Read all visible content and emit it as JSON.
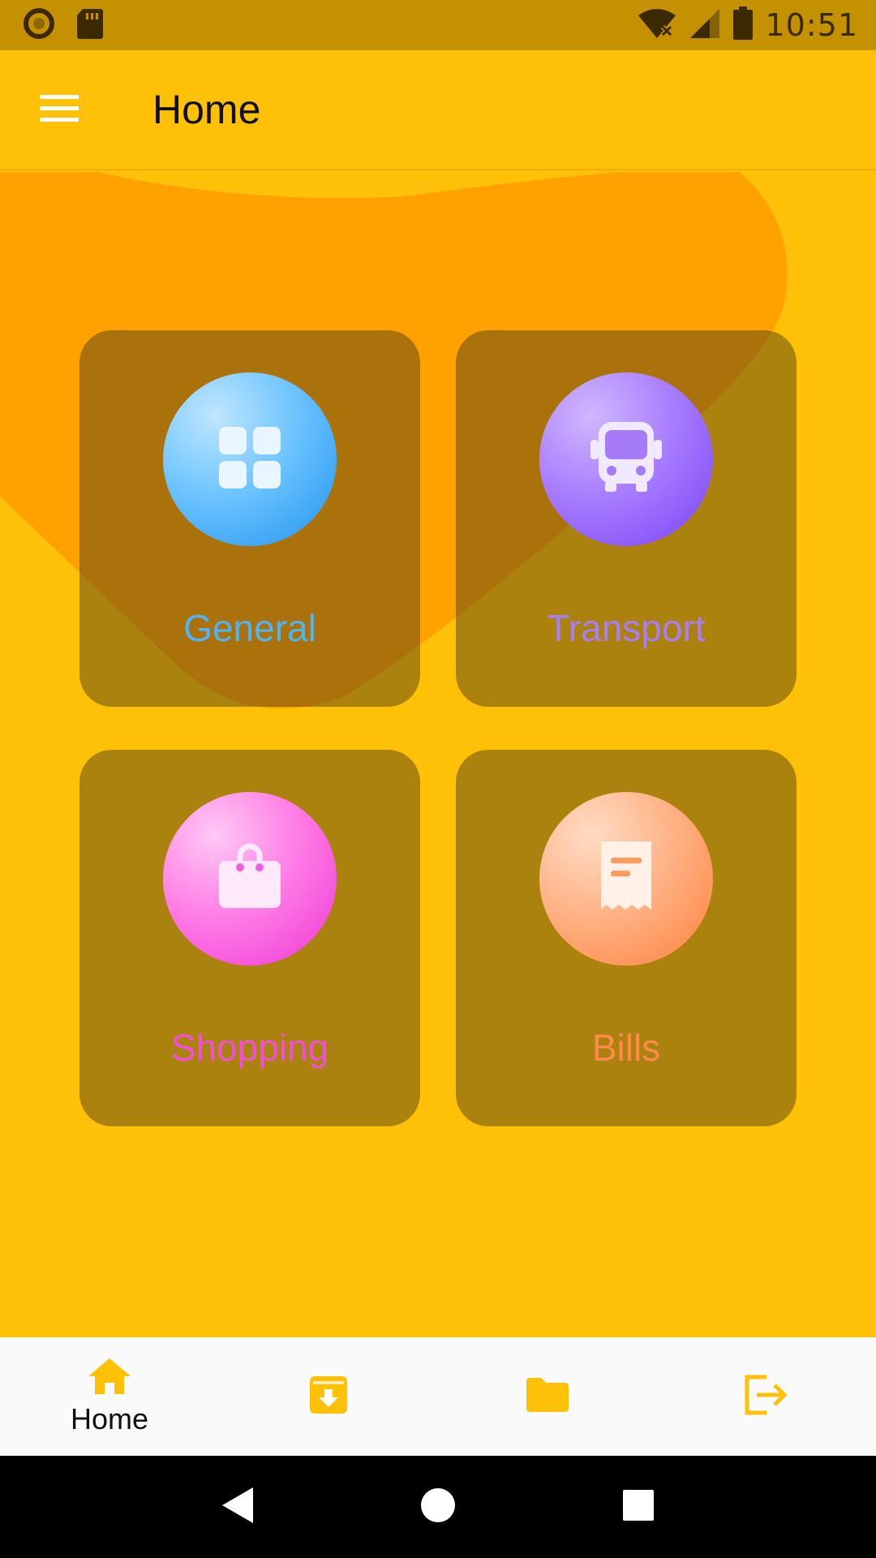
{
  "status_bar": {
    "time": "10:51",
    "icons": [
      "sync-circle-icon",
      "sd-card-icon",
      "wifi-off-icon",
      "cell-signal-icon",
      "battery-icon"
    ]
  },
  "app_bar": {
    "title": "Home",
    "menu_icon": "hamburger-menu-icon"
  },
  "categories": [
    {
      "label": "General",
      "icon": "grid-icon",
      "color": "#4FB3F6"
    },
    {
      "label": "Transport",
      "icon": "bus-icon",
      "color": "#A97EF5"
    },
    {
      "label": "Shopping",
      "icon": "shopping-bag-icon",
      "color": "#F14FD8"
    },
    {
      "label": "Bills",
      "icon": "receipt-icon",
      "color": "#FF8A4C"
    }
  ],
  "bottom_nav": {
    "items": [
      {
        "label": "Home",
        "icon": "home-icon",
        "active": true
      },
      {
        "label": "",
        "icon": "archive-download-icon",
        "active": false
      },
      {
        "label": "",
        "icon": "folder-icon",
        "active": false
      },
      {
        "label": "",
        "icon": "logout-icon",
        "active": false
      }
    ],
    "icon_color": "#FFC107"
  },
  "system_nav": {
    "buttons": [
      "back-icon",
      "home-circle-icon",
      "recents-icon"
    ]
  },
  "colors": {
    "primary": "#FFC107",
    "status_bar": "#C49101",
    "blob": "#FF9F00"
  }
}
